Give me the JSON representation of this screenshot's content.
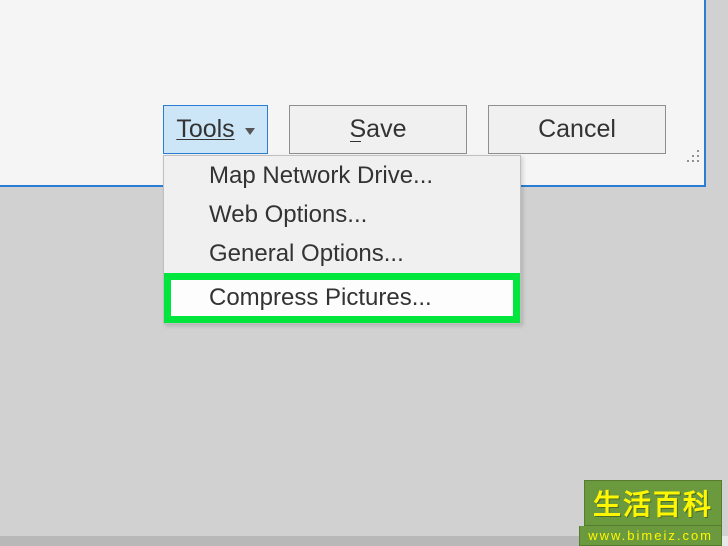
{
  "buttons": {
    "tools_label": "Tools",
    "save_label": "Save",
    "cancel_label": "Cancel"
  },
  "menu": {
    "items": [
      "Map Network Drive...",
      "Web Options...",
      "General Options...",
      "Compress Pictures..."
    ]
  },
  "watermark": {
    "cn_text": "生活百科",
    "url_text": "www.bimeiz.com"
  }
}
